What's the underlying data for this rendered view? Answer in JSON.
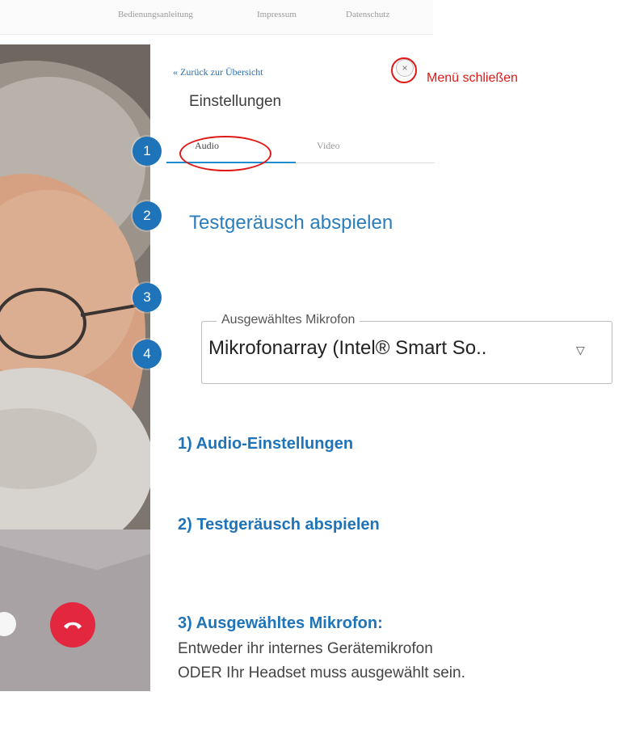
{
  "top_nav": {
    "links": [
      "Bedienungsanleitung",
      "Impressum",
      "Datenschutz"
    ]
  },
  "panel": {
    "back_link": "« Zurück zur Übersicht",
    "title": "Einstellungen",
    "close_icon": "×",
    "tabs": [
      {
        "label": "Audio",
        "active": true
      },
      {
        "label": "Video",
        "active": false
      }
    ],
    "test_sound": "Testgeräusch abspielen",
    "microphone": {
      "legend": "Ausgewähltes Mikrofon",
      "value": "Mikrofonarray (Intel® Smart So..",
      "arrow": "▽"
    }
  },
  "annotation": {
    "close_label": "Menü schließen",
    "color": "#e01818"
  },
  "markers": [
    "1",
    "2",
    "3",
    "4"
  ],
  "instructions": {
    "item1": "1) Audio-Einstellungen",
    "item2": "2) Testgeräusch abspielen",
    "item3_title": "3) Ausgewähltes Mikrofon:",
    "item3_line1": "Entweder ihr internes Gerätemikrofon",
    "item3_line2": "ODER Ihr Headset muss ausgewählt sein."
  },
  "colors": {
    "accent": "#1f73b8",
    "hangup": "#e2273f"
  }
}
